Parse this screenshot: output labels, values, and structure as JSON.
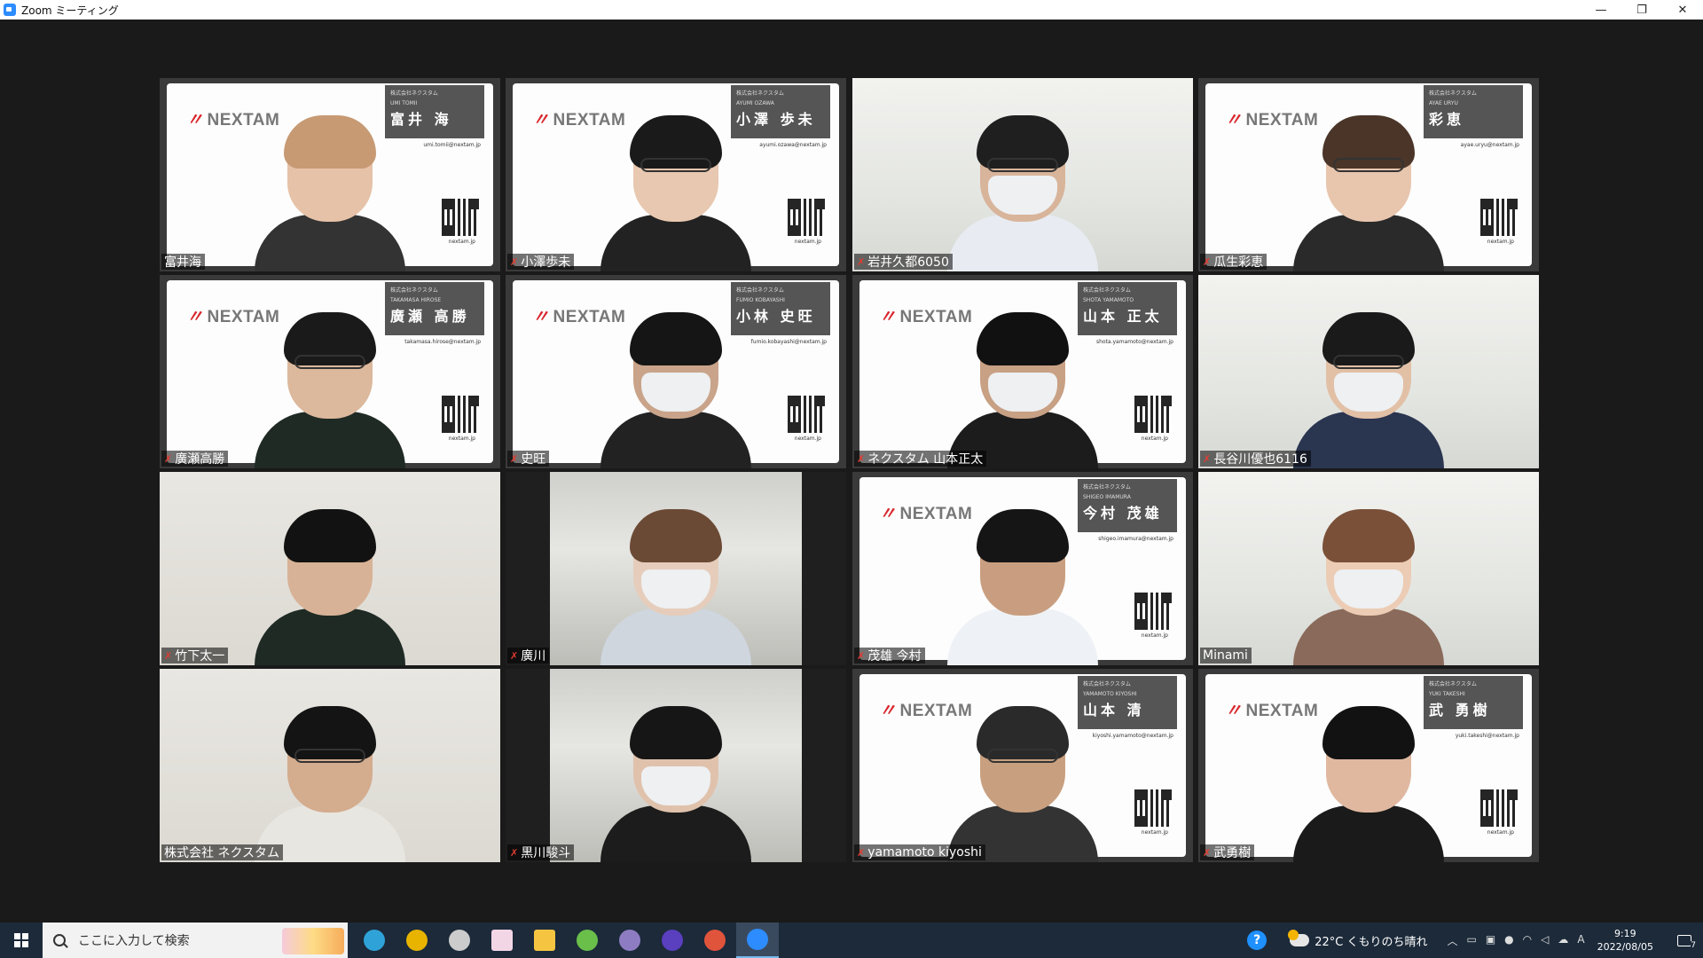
{
  "window": {
    "title": "Zoom ミーティング",
    "controls": {
      "minimize": "—",
      "restore": "❐",
      "close": "✕"
    }
  },
  "participants": [
    {
      "name": "富井海",
      "active": true,
      "muted": false,
      "bg": "card",
      "card": {
        "logo": "NEXTAM",
        "company": "株式会社ネクスタム",
        "roman": "UMI TOMII",
        "kanji": "富井 海",
        "email": "umi.tomii@nextam.jp",
        "site": "nextam.jp"
      },
      "skin": "#e6c2a8",
      "hair": "#c79a74",
      "shirt": "#333333"
    },
    {
      "name": "小澤歩未",
      "muted": true,
      "bg": "card",
      "card": {
        "logo": "NEXTAM",
        "company": "株式会社ネクスタム",
        "roman": "AYUMI OZAWA",
        "kanji": "小澤 歩未",
        "email": "ayumi.ozawa@nextam.jp",
        "site": "nextam.jp"
      },
      "skin": "#e8c8b0",
      "hair": "#1a1a1a",
      "shirt": "#222222",
      "glasses": true
    },
    {
      "name": "岩井久都6050",
      "muted": true,
      "bg": "office",
      "skin": "#d8b49a",
      "hair": "#1f1f1f",
      "shirt": "#e8ecf2",
      "mask": true,
      "glasses": true
    },
    {
      "name": "瓜生彩恵",
      "muted": true,
      "bg": "card",
      "card": {
        "logo": "NEXTAM",
        "company": "株式会社ネクスタム",
        "roman": "AYAE URYU",
        "kanji": "彩恵",
        "email": "ayae.uryu@nextam.jp",
        "site": "nextam.jp"
      },
      "skin": "#e8c6ae",
      "hair": "#4a3528",
      "shirt": "#2a2a2a",
      "glasses": true
    },
    {
      "name": "廣瀬高勝",
      "muted": true,
      "bg": "card",
      "card": {
        "logo": "NEXTAM",
        "company": "株式会社ネクスタム",
        "roman": "TAKAMASA HIROSE",
        "kanji": "廣瀬 高勝",
        "email": "takamasa.hirose@nextam.jp",
        "site": "nextam.jp"
      },
      "skin": "#dcb89c",
      "hair": "#1a1a1a",
      "shirt": "#1f2a24",
      "glasses": true
    },
    {
      "name": "史旺",
      "muted": true,
      "bg": "card",
      "card": {
        "logo": "NEXTAM",
        "company": "株式会社ネクスタム",
        "roman": "FUMIO KOBAYASHI",
        "kanji": "小林 史旺",
        "email": "fumio.kobayashi@nextam.jp",
        "site": "nextam.jp"
      },
      "skin": "#c9a48a",
      "hair": "#151515",
      "shirt": "#222222",
      "mask": true
    },
    {
      "name": "ネクスタム 山本正太",
      "muted": true,
      "bg": "card",
      "card": {
        "logo": "NEXTAM",
        "company": "株式会社ネクスタム",
        "roman": "SHOTA YAMAMOTO",
        "kanji": "山本 正太",
        "email": "shota.yamamoto@nextam.jp",
        "site": "nextam.jp"
      },
      "skin": "#c8a084",
      "hair": "#111111",
      "shirt": "#1c1c1c",
      "mask": true
    },
    {
      "name": "長谷川優也6116",
      "muted": true,
      "bg": "office",
      "skin": "#e2c0a6",
      "hair": "#1a1a1a",
      "shirt": "#2a3550",
      "mask": true,
      "glasses": true
    },
    {
      "name": "竹下太一",
      "muted": true,
      "bg": "room",
      "skin": "#d8b296",
      "hair": "#121212",
      "shirt": "#1f2a24"
    },
    {
      "name": "廣川",
      "muted": true,
      "bg": "ceiling",
      "skin": "#e6cdbb",
      "hair": "#6b4a35",
      "shirt": "#cfd6de",
      "mask": true
    },
    {
      "name": "茂雄 今村",
      "muted": true,
      "bg": "card",
      "card": {
        "logo": "NEXTAM",
        "company": "株式会社ネクスタム",
        "roman": "SHIGEO IMAMURA",
        "kanji": "今村 茂雄",
        "email": "shigeo.imamura@nextam.jp",
        "site": "nextam.jp"
      },
      "skin": "#c99e80",
      "hair": "#151515",
      "shirt": "#eef2f6"
    },
    {
      "name": "Minami",
      "muted": false,
      "bg": "office",
      "skin": "#ecccb4",
      "hair": "#7a5038",
      "shirt": "#8a6a5a",
      "mask": true
    },
    {
      "name": "株式会社 ネクスタム",
      "muted": false,
      "bg": "room",
      "skin": "#d4ac8e",
      "hair": "#141414",
      "shirt": "#e8e6e0",
      "glasses": true
    },
    {
      "name": "黒川駿斗",
      "muted": true,
      "bg": "ceiling",
      "skin": "#e0c2ac",
      "hair": "#161616",
      "shirt": "#1c1c1c",
      "mask": true
    },
    {
      "name": "yamamoto kiyoshi",
      "muted": true,
      "bg": "card",
      "card": {
        "logo": "NEXTAM",
        "company": "株式会社ネクスタム",
        "roman": "YAMAMOTO KIYOSHI",
        "kanji": "山本 清",
        "email": "kiyoshi.yamamoto@nextam.jp",
        "site": "nextam.jp"
      },
      "skin": "#c8a080",
      "hair": "#2a2a2a",
      "shirt": "#333333",
      "glasses": true
    },
    {
      "name": "武勇樹",
      "muted": true,
      "bg": "card",
      "card": {
        "logo": "NEXTAM",
        "company": "株式会社ネクスタム",
        "roman": "YUKI TAKESHI",
        "kanji": "武 勇樹",
        "email": "yuki.takeshi@nextam.jp",
        "site": "nextam.jp"
      },
      "skin": "#e0b8a0",
      "hair": "#121212",
      "shirt": "#1a1a1a"
    }
  ],
  "taskbar": {
    "search_placeholder": "ここに入力して検索",
    "apps": [
      {
        "name": "edge-icon",
        "color": "#2fa3d8"
      },
      {
        "name": "chrome-icon",
        "color": "#e8b400"
      },
      {
        "name": "terminal-icon",
        "color": "#cccccc"
      },
      {
        "name": "notes-icon",
        "color": "#f2d6e6"
      },
      {
        "name": "folder-icon",
        "color": "#f5c542"
      },
      {
        "name": "green-app-icon",
        "color": "#6abf4b"
      },
      {
        "name": "purple-app-icon",
        "color": "#8e7cc3"
      },
      {
        "name": "ms-app-icon",
        "color": "#5a3fbf"
      },
      {
        "name": "chrome-alt-icon",
        "color": "#e0543c"
      },
      {
        "name": "zoom-icon",
        "color": "#2d8cff",
        "active": true
      }
    ],
    "weather": "22°C くもりのち晴れ",
    "time": "9:19",
    "date": "2022/08/05",
    "ime": "A",
    "notifications": "7"
  }
}
